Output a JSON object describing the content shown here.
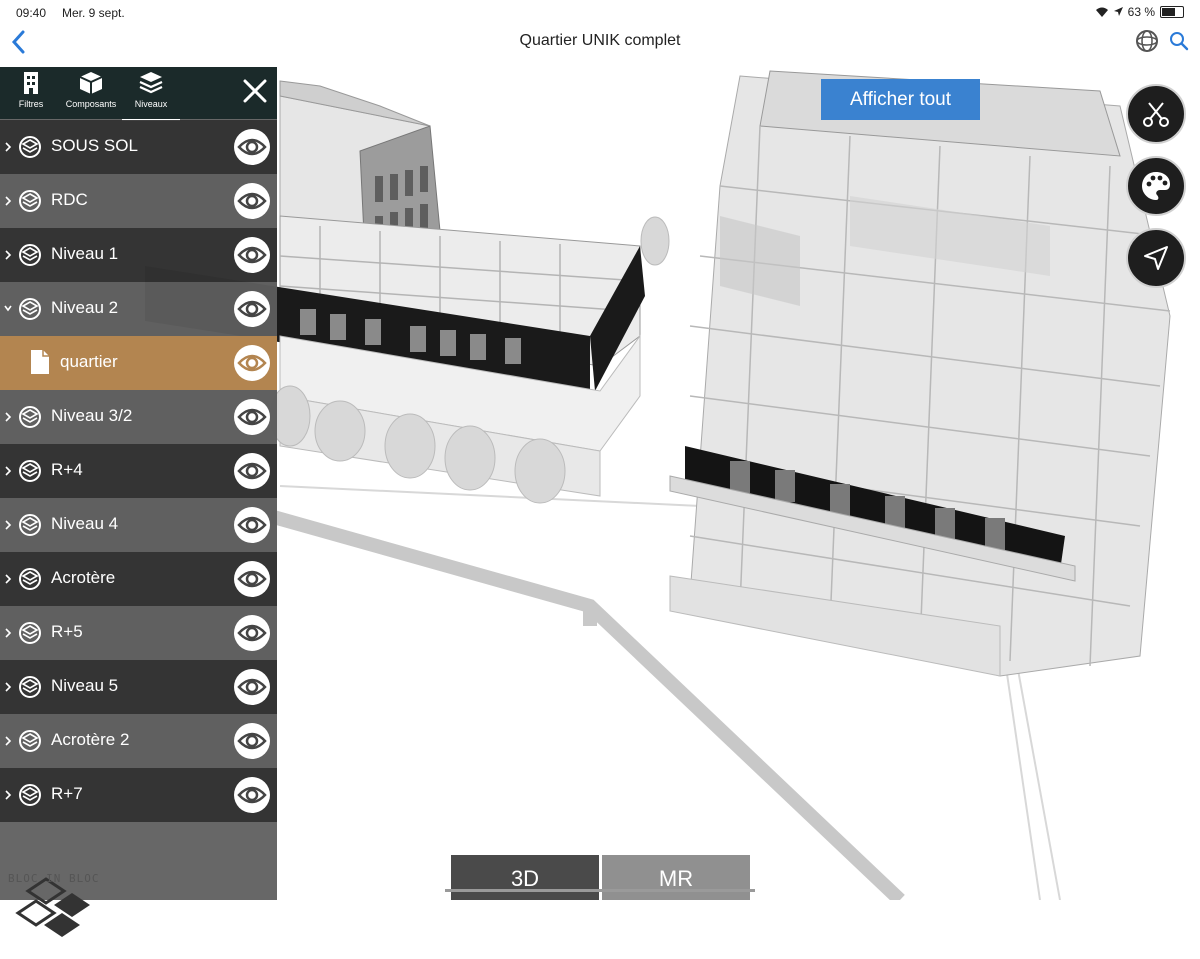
{
  "status_bar": {
    "time": "09:40",
    "date": "Mer. 9 sept.",
    "battery": "63 %",
    "battery_level": 0.63
  },
  "nav": {
    "title": "Quartier UNIK complet"
  },
  "viewport": {
    "show_all_label": "Afficher tout"
  },
  "panel": {
    "tabs": [
      {
        "label": "Filtres",
        "icon": "building-icon"
      },
      {
        "label": "Composants",
        "icon": "cube-icon"
      },
      {
        "label": "Niveaux",
        "icon": "layers-icon"
      }
    ],
    "active_tab": "Niveaux",
    "levels": [
      {
        "label": "SOUS SOL"
      },
      {
        "label": "RDC"
      },
      {
        "label": "Niveau 1"
      },
      {
        "label": "Niveau 2",
        "expanded": true
      },
      {
        "label": "quartier",
        "child": true,
        "selected": true
      },
      {
        "label": "Niveau 3/2"
      },
      {
        "label": "R+4"
      },
      {
        "label": "Niveau 4"
      },
      {
        "label": "Acrotère"
      },
      {
        "label": "R+5"
      },
      {
        "label": "Niveau 5"
      },
      {
        "label": "Acrotère 2"
      },
      {
        "label": "R+7"
      }
    ]
  },
  "logo": {
    "text": "BLOC IN BLOC"
  },
  "bottom_toggle": {
    "options": [
      "3D",
      "MR"
    ],
    "selected": "3D"
  },
  "colors": {
    "accent": "#3a82d0",
    "selected_row": "#b38550",
    "tab_bar": "#1b2a2a"
  }
}
